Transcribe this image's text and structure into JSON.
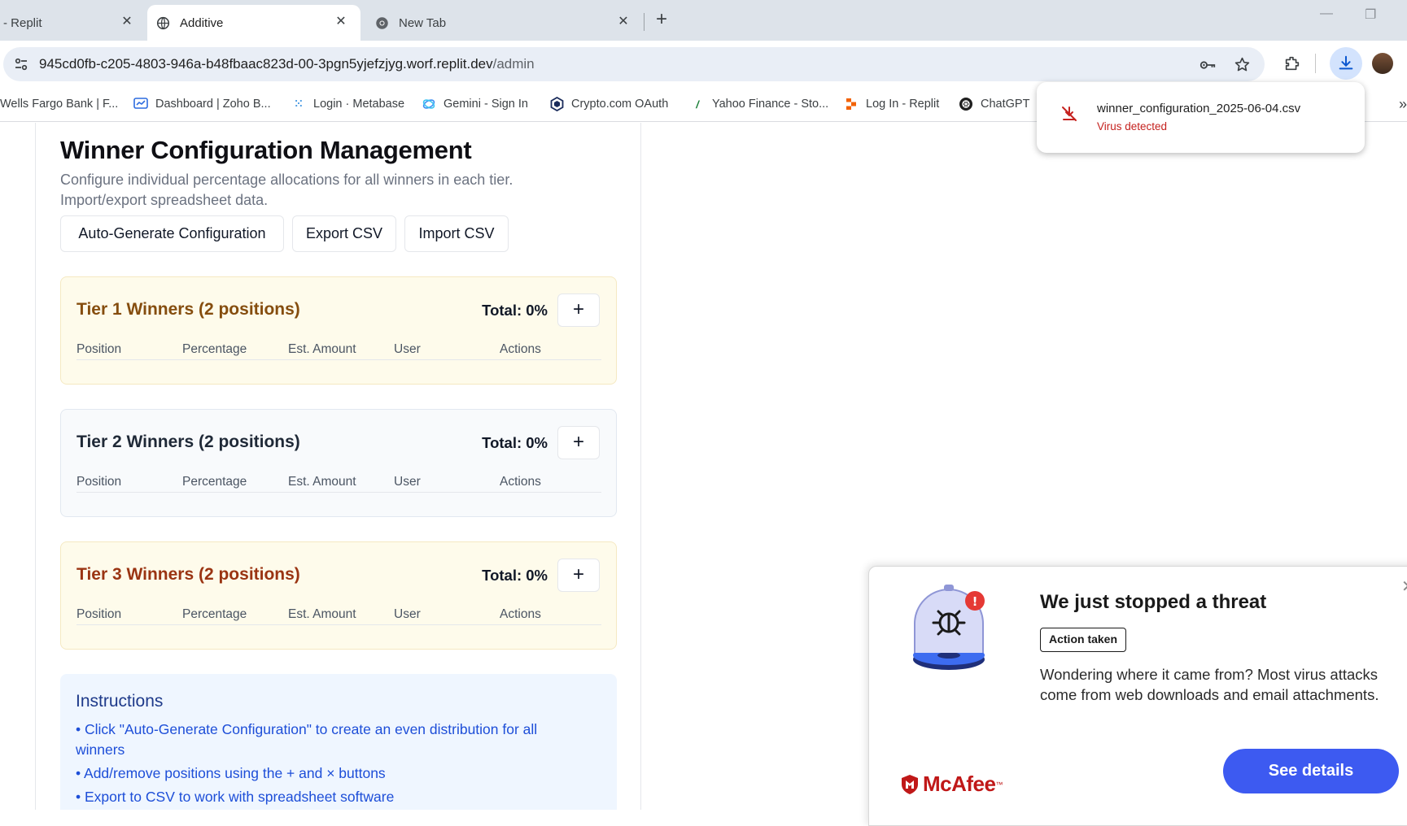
{
  "browser": {
    "tabs": [
      {
        "title": "- Replit",
        "icon": "replit-icon",
        "active": false
      },
      {
        "title": "Additive",
        "icon": "globe-icon",
        "active": true
      },
      {
        "title": "New Tab",
        "icon": "chrome-icon",
        "active": false
      }
    ],
    "tab_close_glyph": "✕",
    "new_tab_glyph": "+",
    "url_host": "945cd0fb-c205-4803-946a-b48fbaac823d-00-3pgn5yjefzjyg.worf.replit.dev",
    "url_path": "/admin",
    "bookmarks": [
      {
        "label": "Wells Fargo Bank | F...",
        "icon": "none"
      },
      {
        "label": "Dashboard | Zoho B...",
        "icon": "zoho-icon"
      },
      {
        "label": "Login · Metabase",
        "icon": "metabase-icon"
      },
      {
        "label": "Gemini - Sign In",
        "icon": "gemini-icon"
      },
      {
        "label": "Crypto.com OAuth",
        "icon": "crypto-icon"
      },
      {
        "label": "Yahoo Finance - Sto...",
        "icon": "yahoo-icon"
      },
      {
        "label": "Log In - Replit",
        "icon": "replit-icon"
      },
      {
        "label": "ChatGPT",
        "icon": "chatgpt-icon"
      }
    ],
    "bookmarks_more": "»"
  },
  "download": {
    "filename": "winner_configuration_2025-06-04.csv",
    "status": "Virus detected",
    "status_color": "#c5221f"
  },
  "page": {
    "title": "Winner Configuration Management",
    "description": "Configure individual percentage allocations for all winners in each tier. Import/export spreadsheet data.",
    "buttons": {
      "auto_generate": "Auto-Generate Configuration",
      "export": "Export CSV",
      "import": "Import CSV"
    },
    "tiers": [
      {
        "name": "Tier 1 Winners (2 positions)",
        "total": "Total: 0%",
        "color": "#854d0e"
      },
      {
        "name": "Tier 2 Winners (2 positions)",
        "total": "Total: 0%",
        "color": "#1f2937"
      },
      {
        "name": "Tier 3 Winners (2 positions)",
        "total": "Total: 0%",
        "color": "#9a3412"
      }
    ],
    "add_glyph": "+",
    "columns": [
      "Position",
      "Percentage",
      "Est. Amount",
      "User",
      "Actions"
    ],
    "instructions": {
      "heading": "Instructions",
      "items": [
        "• Click \"Auto-Generate Configuration\" to create an even distribution for all winners",
        "• Add/remove positions using the + and × buttons",
        "• Export to CSV to work with spreadsheet software"
      ]
    }
  },
  "mcafee": {
    "title": "We just stopped a threat",
    "badge": "Action taken",
    "body": "Wondering where it came from? Most virus attacks come from web downloads and email attachments.",
    "button": "See details",
    "brand": "McAfee",
    "trademark": "™",
    "close_glyph": "✕",
    "accent": "#3d5af1",
    "brand_color": "#c01818"
  }
}
